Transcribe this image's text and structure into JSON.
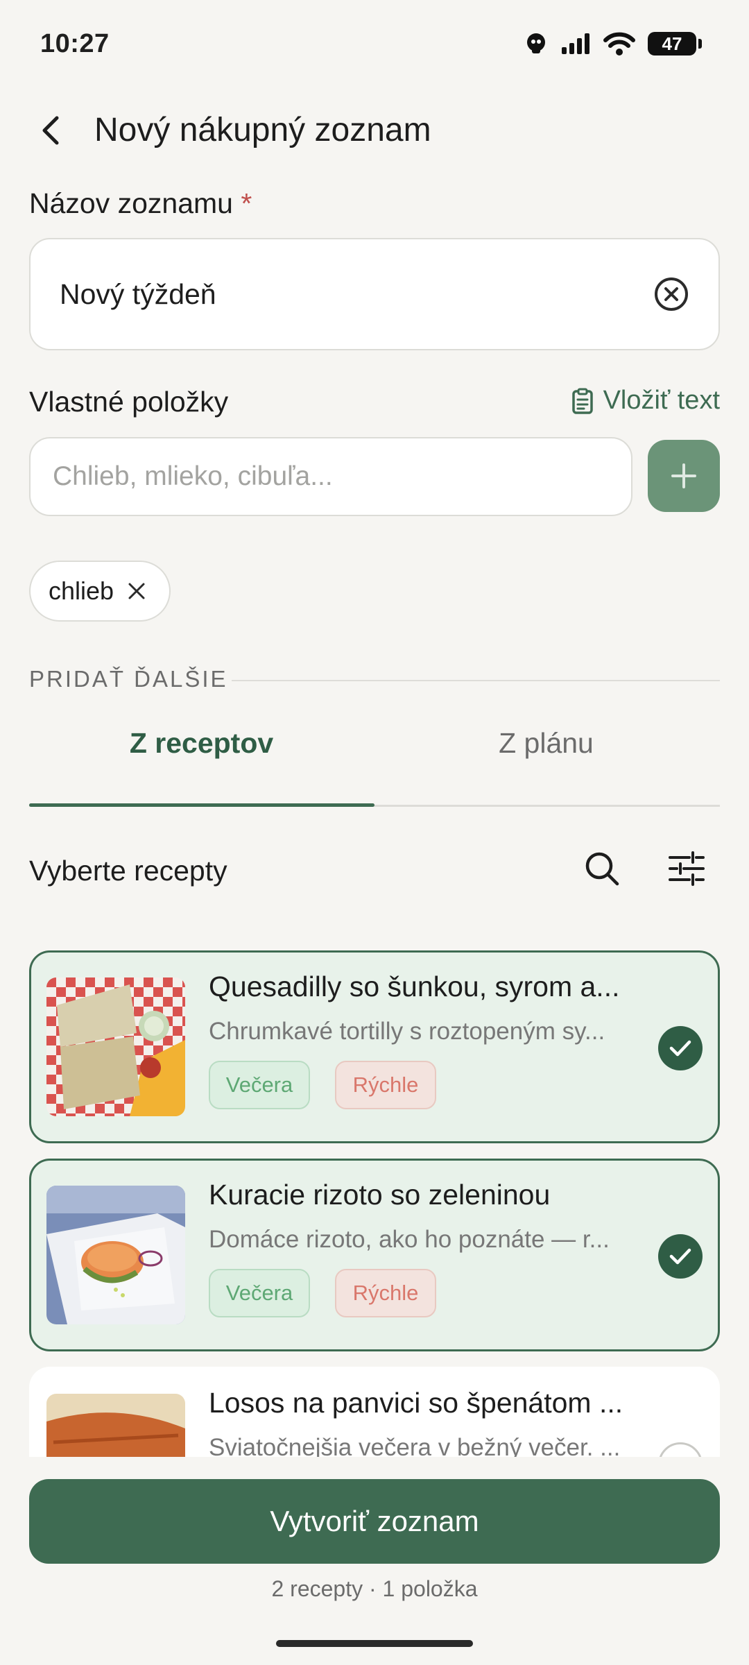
{
  "status_bar": {
    "time": "10:27",
    "battery": "47"
  },
  "header": {
    "title": "Nový nákupný zoznam"
  },
  "name_field": {
    "label": "Názov zoznamu",
    "required_mark": "*",
    "value": "Nový týždeň"
  },
  "custom_items": {
    "label": "Vlastné položky",
    "paste_label": "Vložiť text",
    "placeholder": "Chlieb, mlieko, cibuľa...",
    "chips": [
      "chlieb"
    ]
  },
  "section": {
    "label": "PRIDAŤ ĎALŠIE"
  },
  "tabs": [
    {
      "label": "Z receptov",
      "active": true
    },
    {
      "label": "Z plánu",
      "active": false
    }
  ],
  "recipes_header": {
    "title": "Vyberte recepty"
  },
  "recipes": [
    {
      "title": "Quesadilly so šunkou, syrom a...",
      "description": "Chrumkavé tortilly s roztopeným sy...",
      "tags": [
        "Večera",
        "Rýchle"
      ],
      "selected": true
    },
    {
      "title": "Kuracie rizoto so zeleninou",
      "description": "Domáce rizoto, ako ho poznáte — r...",
      "tags": [
        "Večera",
        "Rýchle"
      ],
      "selected": true
    },
    {
      "title": "Losos na panvici so špenátom ...",
      "description": "Sviatočnejšia večera v bežný večer. ...",
      "tags": [],
      "selected": false
    }
  ],
  "footer": {
    "create_label": "Vytvoriť zoznam",
    "summary": "2 recepty · 1 položka"
  },
  "colors": {
    "accent": "#3e6b52",
    "background": "#f6f5f2",
    "selected_card": "#e8f2ea"
  }
}
